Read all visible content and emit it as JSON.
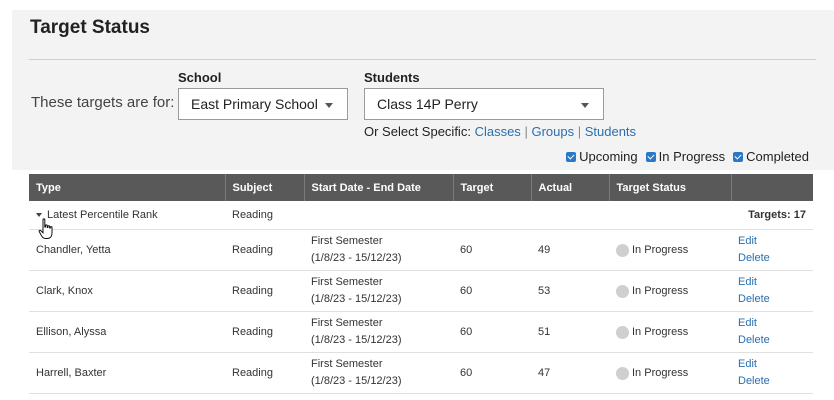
{
  "header": {
    "title": "Target Status"
  },
  "filters": {
    "for_label": "These targets are for:",
    "school_label": "School",
    "school_value": "East Primary School",
    "students_label": "Students",
    "students_value": "Class 14P Perry",
    "or_select": "Or Select Specific:",
    "links": [
      "Classes",
      "Groups",
      "Students"
    ],
    "separator": "|",
    "checkboxes": [
      {
        "label": "Upcoming",
        "checked": true
      },
      {
        "label": "In Progress",
        "checked": true
      },
      {
        "label": "Completed",
        "checked": true
      }
    ]
  },
  "table": {
    "columns": [
      "Type",
      "Subject",
      "Start Date - End Date",
      "Target",
      "Actual",
      "Target Status",
      ""
    ],
    "group": {
      "type": "Latest Percentile Rank",
      "subject": "Reading",
      "targets_count": "Targets: 17"
    },
    "rows": [
      {
        "name": "Chandler, Yetta",
        "subject": "Reading",
        "period": "First Semester",
        "dates": "(1/8/23 - 15/12/23)",
        "target": "60",
        "actual": "49",
        "status": "In Progress",
        "edit": "Edit",
        "delete": "Delete"
      },
      {
        "name": "Clark, Knox",
        "subject": "Reading",
        "period": "First Semester",
        "dates": "(1/8/23 - 15/12/23)",
        "target": "60",
        "actual": "53",
        "status": "In Progress",
        "edit": "Edit",
        "delete": "Delete"
      },
      {
        "name": "Ellison, Alyssa",
        "subject": "Reading",
        "period": "First Semester",
        "dates": "(1/8/23 - 15/12/23)",
        "target": "60",
        "actual": "51",
        "status": "In Progress",
        "edit": "Edit",
        "delete": "Delete"
      },
      {
        "name": "Harrell, Baxter",
        "subject": "Reading",
        "period": "First Semester",
        "dates": "(1/8/23 - 15/12/23)",
        "target": "60",
        "actual": "47",
        "status": "In Progress",
        "edit": "Edit",
        "delete": "Delete"
      }
    ]
  },
  "colors": {
    "header_bg": "#595959",
    "link": "#2a6fb0",
    "checkbox": "#2a79c8",
    "status_dot": "#cfcfcf"
  },
  "icons": {
    "cursor": "hand-pointer-icon",
    "expand": "collapse-triangle-icon",
    "status": "status-dot-icon"
  }
}
